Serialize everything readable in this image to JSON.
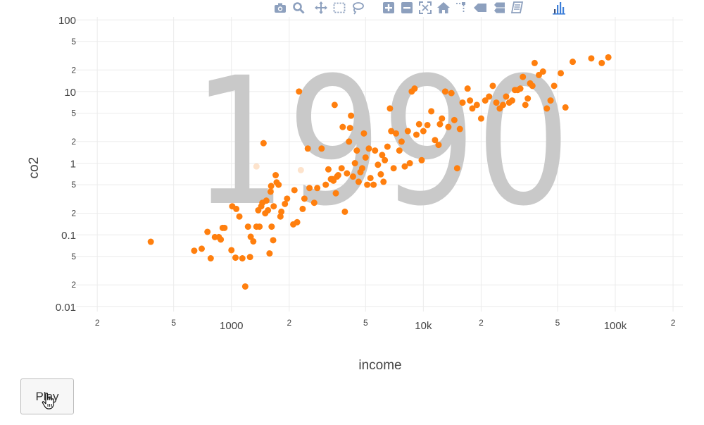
{
  "toolbar": {
    "icons": [
      "camera-icon",
      "zoom-icon",
      "pan-icon",
      "box-select-icon",
      "lasso-select-icon",
      "zoom-in-icon",
      "zoom-out-icon",
      "autoscale-icon",
      "reset-axes-icon",
      "spike-lines-icon",
      "hover-closest-icon",
      "hover-compare-icon",
      "docs-icon",
      "plotly-logo-icon"
    ],
    "color": "#8da0be"
  },
  "play_button": {
    "label": "Play"
  },
  "chart_data": {
    "type": "scatter",
    "year_label": "1990",
    "xlabel": "income",
    "ylabel": "co2",
    "x_scale": "log",
    "y_scale": "log",
    "xlim": [
      155,
      225000
    ],
    "ylim": [
      0.0085,
      110
    ],
    "grid": true,
    "point_color": "#ff7f0e",
    "faded_point_color": "#fde3cc",
    "x_ticks": [
      {
        "value": 200,
        "label": "2",
        "major": false
      },
      {
        "value": 500,
        "label": "5",
        "major": false
      },
      {
        "value": 1000,
        "label": "1000",
        "major": true
      },
      {
        "value": 2000,
        "label": "2",
        "major": false
      },
      {
        "value": 5000,
        "label": "5",
        "major": false
      },
      {
        "value": 10000,
        "label": "10k",
        "major": true
      },
      {
        "value": 20000,
        "label": "2",
        "major": false
      },
      {
        "value": 50000,
        "label": "5",
        "major": false
      },
      {
        "value": 100000,
        "label": "100k",
        "major": true
      },
      {
        "value": 200000,
        "label": "2",
        "major": false
      }
    ],
    "y_ticks": [
      {
        "value": 0.01,
        "label": "0.01",
        "major": true
      },
      {
        "value": 0.02,
        "label": "2",
        "major": false
      },
      {
        "value": 0.05,
        "label": "5",
        "major": false
      },
      {
        "value": 0.1,
        "label": "0.1",
        "major": true
      },
      {
        "value": 0.2,
        "label": "2",
        "major": false
      },
      {
        "value": 0.5,
        "label": "5",
        "major": false
      },
      {
        "value": 1,
        "label": "1",
        "major": true
      },
      {
        "value": 2,
        "label": "2",
        "major": false
      },
      {
        "value": 5,
        "label": "5",
        "major": false
      },
      {
        "value": 10,
        "label": "10",
        "major": true
      },
      {
        "value": 20,
        "label": "2",
        "major": false
      },
      {
        "value": 50,
        "label": "5",
        "major": false
      },
      {
        "value": 100,
        "label": "100",
        "major": true
      }
    ],
    "points": [
      [
        380,
        0.08
      ],
      [
        640,
        0.06
      ],
      [
        700,
        0.064
      ],
      [
        750,
        0.11
      ],
      [
        780,
        0.047
      ],
      [
        820,
        0.093
      ],
      [
        860,
        0.093
      ],
      [
        880,
        0.086
      ],
      [
        900,
        0.125
      ],
      [
        920,
        0.125
      ],
      [
        1000,
        0.061
      ],
      [
        1010,
        0.25
      ],
      [
        1050,
        0.048
      ],
      [
        1060,
        0.23
      ],
      [
        1100,
        0.18
      ],
      [
        1140,
        0.047
      ],
      [
        1180,
        0.019
      ],
      [
        1220,
        0.13
      ],
      [
        1250,
        0.049
      ],
      [
        1260,
        0.094
      ],
      [
        1300,
        0.081
      ],
      [
        1350,
        0.13
      ],
      [
        1380,
        0.22
      ],
      [
        1400,
        0.13
      ],
      [
        1430,
        0.25
      ],
      [
        1450,
        0.28
      ],
      [
        1470,
        1.9
      ],
      [
        1500,
        0.2
      ],
      [
        1520,
        0.3
      ],
      [
        1550,
        0.22
      ],
      [
        1580,
        0.055
      ],
      [
        1600,
        0.4
      ],
      [
        1610,
        0.48
      ],
      [
        1620,
        0.13
      ],
      [
        1650,
        0.084
      ],
      [
        1660,
        0.25
      ],
      [
        1700,
        0.68
      ],
      [
        1720,
        0.54
      ],
      [
        1760,
        0.5
      ],
      [
        1800,
        0.18
      ],
      [
        1820,
        0.21
      ],
      [
        1900,
        0.27
      ],
      [
        1950,
        0.32
      ],
      [
        2100,
        0.14
      ],
      [
        2130,
        0.42
      ],
      [
        2200,
        0.15
      ],
      [
        2250,
        10
      ],
      [
        2350,
        0.23
      ],
      [
        2400,
        0.32
      ],
      [
        2500,
        1.6
      ],
      [
        2550,
        0.45
      ],
      [
        2700,
        0.28
      ],
      [
        2800,
        0.45
      ],
      [
        2950,
        1.6
      ],
      [
        3100,
        0.5
      ],
      [
        3200,
        0.82
      ],
      [
        3300,
        0.6
      ],
      [
        3350,
        0.6
      ],
      [
        3400,
        0.57
      ],
      [
        3450,
        6.5
      ],
      [
        3500,
        0.38
      ],
      [
        3550,
        0.65
      ],
      [
        3600,
        0.68
      ],
      [
        3750,
        0.85
      ],
      [
        3800,
        3.2
      ],
      [
        3900,
        0.21
      ],
      [
        4000,
        0.72
      ],
      [
        4100,
        2
      ],
      [
        4150,
        3.1
      ],
      [
        4200,
        4.6
      ],
      [
        4300,
        0.65
      ],
      [
        4400,
        1
      ],
      [
        4500,
        1.5
      ],
      [
        4600,
        0.55
      ],
      [
        4700,
        0.75
      ],
      [
        4800,
        0.85
      ],
      [
        4900,
        2.6
      ],
      [
        5000,
        1.2
      ],
      [
        5100,
        0.5
      ],
      [
        5200,
        1.6
      ],
      [
        5300,
        0.62
      ],
      [
        5500,
        0.5
      ],
      [
        5600,
        1.5
      ],
      [
        5800,
        0.95
      ],
      [
        6000,
        0.7
      ],
      [
        6100,
        1.3
      ],
      [
        6200,
        0.55
      ],
      [
        6300,
        1.1
      ],
      [
        6500,
        1.7
      ],
      [
        6700,
        5.8
      ],
      [
        6800,
        2.8
      ],
      [
        7000,
        0.85
      ],
      [
        7200,
        2.6
      ],
      [
        7500,
        1.5
      ],
      [
        7700,
        2
      ],
      [
        8000,
        0.9
      ],
      [
        8300,
        2.8
      ],
      [
        8500,
        1
      ],
      [
        8700,
        10
      ],
      [
        9000,
        11
      ],
      [
        9200,
        2.5
      ],
      [
        9500,
        3.5
      ],
      [
        9800,
        1.1
      ],
      [
        10000,
        2.8
      ],
      [
        10500,
        3.4
      ],
      [
        11000,
        5.3
      ],
      [
        11500,
        2.1
      ],
      [
        12000,
        1.8
      ],
      [
        12200,
        3.5
      ],
      [
        12500,
        4.2
      ],
      [
        13000,
        10
      ],
      [
        13500,
        3.2
      ],
      [
        14000,
        9.5
      ],
      [
        14500,
        4
      ],
      [
        15000,
        0.85
      ],
      [
        15500,
        3
      ],
      [
        16000,
        7
      ],
      [
        17000,
        11
      ],
      [
        17500,
        7.5
      ],
      [
        18000,
        5.8
      ],
      [
        19000,
        6.5
      ],
      [
        20000,
        4.2
      ],
      [
        21000,
        7.5
      ],
      [
        22000,
        8.5
      ],
      [
        23000,
        12
      ],
      [
        24000,
        7
      ],
      [
        25000,
        5.8
      ],
      [
        26000,
        6.5
      ],
      [
        27000,
        8.5
      ],
      [
        28000,
        7
      ],
      [
        29000,
        7.5
      ],
      [
        30000,
        10.5
      ],
      [
        31000,
        10.5
      ],
      [
        32000,
        11
      ],
      [
        33000,
        16
      ],
      [
        34000,
        6.5
      ],
      [
        35000,
        8
      ],
      [
        36000,
        13
      ],
      [
        37000,
        12
      ],
      [
        38000,
        25
      ],
      [
        40000,
        17
      ],
      [
        42000,
        19
      ],
      [
        44000,
        5.8
      ],
      [
        46000,
        7.5
      ],
      [
        48000,
        12
      ],
      [
        52000,
        18
      ],
      [
        55000,
        6
      ],
      [
        60000,
        26
      ],
      [
        75000,
        29
      ],
      [
        85000,
        25
      ],
      [
        92000,
        30
      ]
    ],
    "faded_points": [
      [
        1350,
        0.9
      ],
      [
        1600,
        0.42
      ],
      [
        2300,
        0.8
      ]
    ]
  }
}
